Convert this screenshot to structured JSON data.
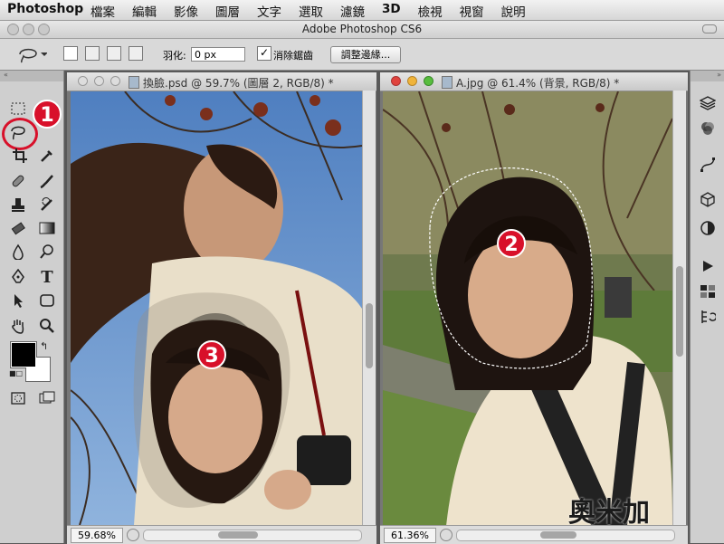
{
  "menubar": {
    "app_name": "Photoshop",
    "menus": [
      "檔案",
      "編輯",
      "影像",
      "圖層",
      "文字",
      "選取",
      "濾鏡",
      "3D",
      "檢視",
      "視窗",
      "說明"
    ]
  },
  "window": {
    "title": "Adobe Photoshop CS6"
  },
  "options_bar": {
    "feather_label": "羽化:",
    "feather_value": "0 px",
    "antialias_label": "消除鋸齒",
    "antialias_checked": true,
    "refine_edge_label": "調整邊緣..."
  },
  "documents": [
    {
      "title": "換臉.psd @ 59.7% (圖層 2, RGB/8) *",
      "zoom": "59.68%"
    },
    {
      "title": "A.jpg @ 61.4% (背景, RGB/8) *",
      "zoom": "61.36%"
    }
  ],
  "annotations": [
    "1",
    "2",
    "3"
  ],
  "watermark": "奧米加",
  "colors": {
    "accent_red": "#d8102a",
    "foreground": "#000000",
    "background": "#ffffff"
  }
}
